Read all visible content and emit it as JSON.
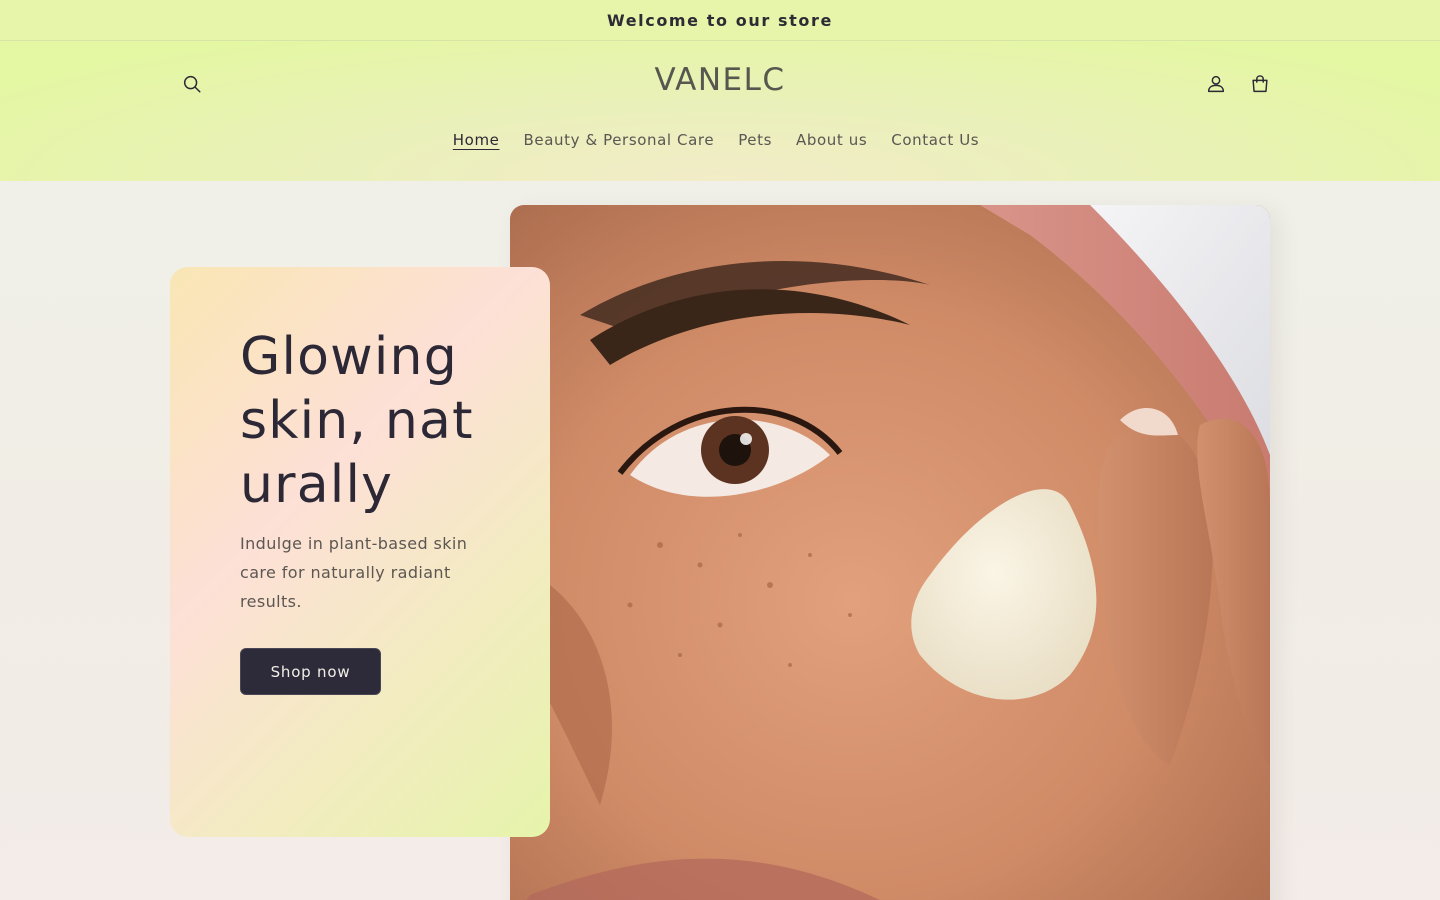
{
  "announcement": {
    "text": "Welcome to our store"
  },
  "header": {
    "logo": "VANELC",
    "icons": {
      "search": "search-icon",
      "account": "user-icon",
      "cart": "shopping-bag-icon"
    }
  },
  "nav": {
    "items": [
      {
        "label": "Home",
        "active": true
      },
      {
        "label": "Beauty & Personal Care",
        "active": false
      },
      {
        "label": "Pets",
        "active": false
      },
      {
        "label": "About us",
        "active": false
      },
      {
        "label": "Contact Us",
        "active": false
      }
    ]
  },
  "hero": {
    "title": "Glowing skin, naturally",
    "subtitle": "Indulge in plant-based skin care for naturally radiant results.",
    "button_label": "Shop now"
  },
  "colors": {
    "announcement_bg": "#e6f5aa",
    "button_bg": "#2d2a3a",
    "text_dark": "#2c2836"
  }
}
